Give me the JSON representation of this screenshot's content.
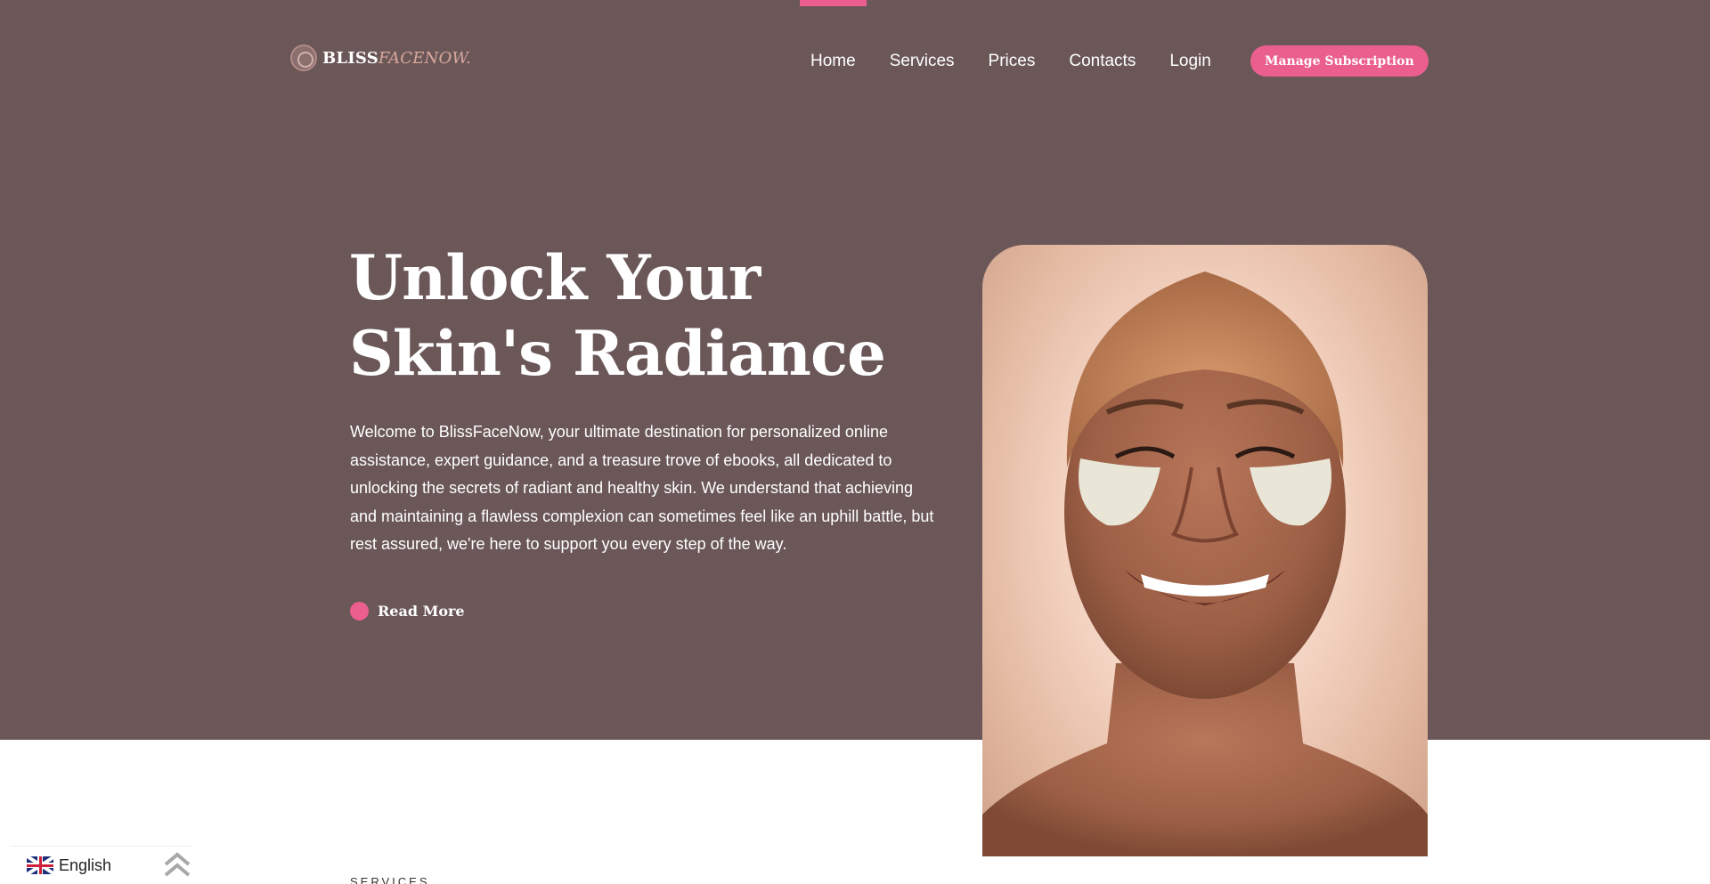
{
  "brand": {
    "name_main": "BLISS",
    "name_accent": "FACENOW."
  },
  "nav": {
    "items": [
      {
        "label": "Home",
        "name": "nav-home"
      },
      {
        "label": "Services",
        "name": "nav-services"
      },
      {
        "label": "Prices",
        "name": "nav-prices"
      },
      {
        "label": "Contacts",
        "name": "nav-contacts"
      },
      {
        "label": "Login",
        "name": "nav-login"
      }
    ],
    "cta_label": "Manage Subscription"
  },
  "hero": {
    "title": "Unlock Your Skin's Radiance",
    "text": "Welcome to BlissFaceNow, your ultimate destination for personalized online assistance, expert guidance, and a treasure trove of ebooks, all dedicated to unlocking the secrets of radiant and healthy skin. We understand that achieving and maintaining a flawless complexion can sometimes feel like an uphill battle, but rest assured, we're here to support you every step of the way.",
    "read_more_label": "Read More"
  },
  "services": {
    "section_label": "SERVICES"
  },
  "language": {
    "selected": "English",
    "flag_icon": "uk-flag-icon"
  },
  "colors": {
    "hero_bg": "#6b5758",
    "accent": "#ea5f8e",
    "white": "#ffffff"
  }
}
